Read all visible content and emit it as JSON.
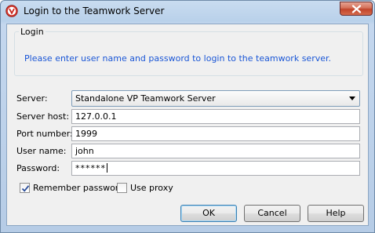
{
  "window": {
    "title": "Login to the Teamwork Server"
  },
  "group": {
    "label": "Login",
    "message": "Please enter user name and password to login to the teamwork server."
  },
  "form": {
    "server_label": "Server:",
    "server_value": "Standalone VP Teamwork Server",
    "host_label": "Server host:",
    "host_value": "127.0.0.1",
    "port_label": "Port number:",
    "port_value": "1999",
    "user_label": "User name:",
    "user_value": "john",
    "password_label": "Password:",
    "password_value": "******"
  },
  "options": {
    "remember_label": "Remember password",
    "remember_checked": true,
    "proxy_label": "Use proxy",
    "proxy_checked": false
  },
  "buttons": {
    "ok": "OK",
    "cancel": "Cancel",
    "help": "Help"
  },
  "colors": {
    "message_text": "#1a56d6",
    "close_button": "#c1442a",
    "title_bar": "#b9d1ea"
  },
  "icons": {
    "app": "vp-logo-icon",
    "close": "close-icon",
    "dropdown": "chevron-down-icon",
    "check": "checkmark-icon"
  }
}
